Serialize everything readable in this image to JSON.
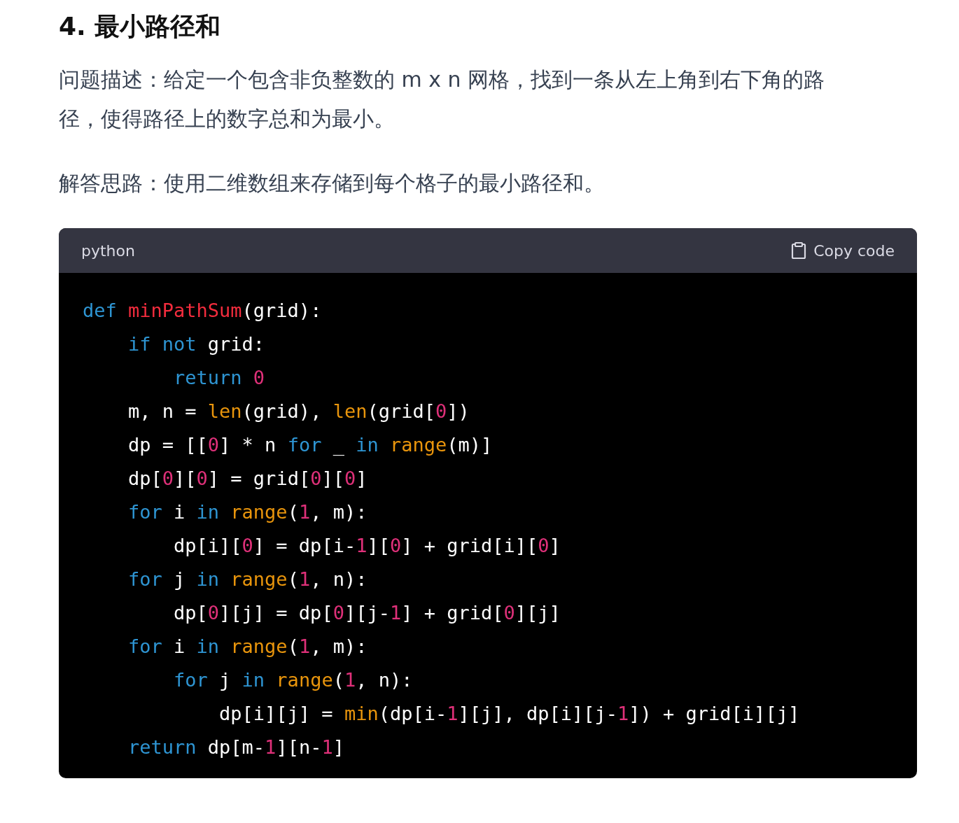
{
  "heading": "4. 最小路径和",
  "paragraphs": [
    "问题描述：给定一个包含非负整数的 m x n 网格，找到一条从左上角到右下角的路径，使得路径上的数字总和为最小。",
    "解答思路：使用二维数组来存储到每个格子的最小路径和。"
  ],
  "code_block": {
    "language": "python",
    "copy_label": "Copy code",
    "lines": [
      [
        {
          "kind": "keyword",
          "text": "def"
        },
        {
          "kind": "function",
          "text": " minPathSum"
        },
        {
          "kind": "plain",
          "text": "(grid):"
        }
      ],
      [
        {
          "kind": "keyword",
          "text": "    if"
        },
        {
          "kind": "keyword",
          "text": " not"
        },
        {
          "kind": "plain",
          "text": " grid:"
        }
      ],
      [
        {
          "kind": "keyword",
          "text": "        return"
        },
        {
          "kind": "number",
          "text": " 0"
        }
      ],
      [
        {
          "kind": "plain",
          "text": "    m, n = "
        },
        {
          "kind": "builtin",
          "text": "len"
        },
        {
          "kind": "plain",
          "text": "(grid), "
        },
        {
          "kind": "builtin",
          "text": "len"
        },
        {
          "kind": "plain",
          "text": "(grid["
        },
        {
          "kind": "number",
          "text": "0"
        },
        {
          "kind": "plain",
          "text": "])"
        }
      ],
      [
        {
          "kind": "plain",
          "text": "    dp = [["
        },
        {
          "kind": "number",
          "text": "0"
        },
        {
          "kind": "plain",
          "text": "] * n "
        },
        {
          "kind": "keyword",
          "text": "for"
        },
        {
          "kind": "plain",
          "text": " _ "
        },
        {
          "kind": "keyword",
          "text": "in"
        },
        {
          "kind": "builtin",
          "text": " range"
        },
        {
          "kind": "plain",
          "text": "(m)]"
        }
      ],
      [
        {
          "kind": "plain",
          "text": "    dp["
        },
        {
          "kind": "number",
          "text": "0"
        },
        {
          "kind": "plain",
          "text": "]["
        },
        {
          "kind": "number",
          "text": "0"
        },
        {
          "kind": "plain",
          "text": "] = grid["
        },
        {
          "kind": "number",
          "text": "0"
        },
        {
          "kind": "plain",
          "text": "]["
        },
        {
          "kind": "number",
          "text": "0"
        },
        {
          "kind": "plain",
          "text": "]"
        }
      ],
      [
        {
          "kind": "keyword",
          "text": "    for"
        },
        {
          "kind": "plain",
          "text": " i "
        },
        {
          "kind": "keyword",
          "text": "in"
        },
        {
          "kind": "builtin",
          "text": " range"
        },
        {
          "kind": "plain",
          "text": "("
        },
        {
          "kind": "number",
          "text": "1"
        },
        {
          "kind": "plain",
          "text": ", m):"
        }
      ],
      [
        {
          "kind": "plain",
          "text": "        dp[i]["
        },
        {
          "kind": "number",
          "text": "0"
        },
        {
          "kind": "plain",
          "text": "] = dp[i-"
        },
        {
          "kind": "number",
          "text": "1"
        },
        {
          "kind": "plain",
          "text": "]["
        },
        {
          "kind": "number",
          "text": "0"
        },
        {
          "kind": "plain",
          "text": "] + grid[i]["
        },
        {
          "kind": "number",
          "text": "0"
        },
        {
          "kind": "plain",
          "text": "]"
        }
      ],
      [
        {
          "kind": "keyword",
          "text": "    for"
        },
        {
          "kind": "plain",
          "text": " j "
        },
        {
          "kind": "keyword",
          "text": "in"
        },
        {
          "kind": "builtin",
          "text": " range"
        },
        {
          "kind": "plain",
          "text": "("
        },
        {
          "kind": "number",
          "text": "1"
        },
        {
          "kind": "plain",
          "text": ", n):"
        }
      ],
      [
        {
          "kind": "plain",
          "text": "        dp["
        },
        {
          "kind": "number",
          "text": "0"
        },
        {
          "kind": "plain",
          "text": "][j] = dp["
        },
        {
          "kind": "number",
          "text": "0"
        },
        {
          "kind": "plain",
          "text": "][j-"
        },
        {
          "kind": "number",
          "text": "1"
        },
        {
          "kind": "plain",
          "text": "] + grid["
        },
        {
          "kind": "number",
          "text": "0"
        },
        {
          "kind": "plain",
          "text": "][j]"
        }
      ],
      [
        {
          "kind": "keyword",
          "text": "    for"
        },
        {
          "kind": "plain",
          "text": " i "
        },
        {
          "kind": "keyword",
          "text": "in"
        },
        {
          "kind": "builtin",
          "text": " range"
        },
        {
          "kind": "plain",
          "text": "("
        },
        {
          "kind": "number",
          "text": "1"
        },
        {
          "kind": "plain",
          "text": ", m):"
        }
      ],
      [
        {
          "kind": "keyword",
          "text": "        for"
        },
        {
          "kind": "plain",
          "text": " j "
        },
        {
          "kind": "keyword",
          "text": "in"
        },
        {
          "kind": "builtin",
          "text": " range"
        },
        {
          "kind": "plain",
          "text": "("
        },
        {
          "kind": "number",
          "text": "1"
        },
        {
          "kind": "plain",
          "text": ", n):"
        }
      ],
      [
        {
          "kind": "plain",
          "text": "            dp[i][j] = "
        },
        {
          "kind": "builtin",
          "text": "min"
        },
        {
          "kind": "plain",
          "text": "(dp[i-"
        },
        {
          "kind": "number",
          "text": "1"
        },
        {
          "kind": "plain",
          "text": "][j], dp[i][j-"
        },
        {
          "kind": "number",
          "text": "1"
        },
        {
          "kind": "plain",
          "text": "]) + grid[i][j]"
        }
      ],
      [
        {
          "kind": "keyword",
          "text": "    return"
        },
        {
          "kind": "plain",
          "text": " dp[m-"
        },
        {
          "kind": "number",
          "text": "1"
        },
        {
          "kind": "plain",
          "text": "][n-"
        },
        {
          "kind": "number",
          "text": "1"
        },
        {
          "kind": "plain",
          "text": "]"
        }
      ]
    ]
  }
}
